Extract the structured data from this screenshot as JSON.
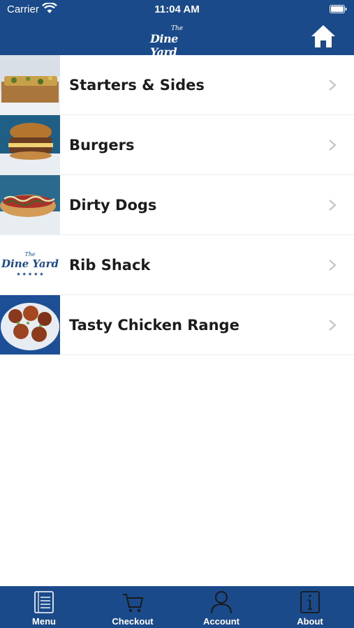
{
  "status_bar": {
    "carrier": "Carrier",
    "time": "11:04 AM"
  },
  "header": {
    "logo_small": "The",
    "logo_name": "Dine Yard",
    "home_icon": "home-icon",
    "brand_color": "#1a4a8a"
  },
  "categories": [
    {
      "label": "Starters & Sides",
      "thumb": "loaded-fries-photo"
    },
    {
      "label": "Burgers",
      "thumb": "burger-photo"
    },
    {
      "label": "Dirty Dogs",
      "thumb": "hotdog-photo"
    },
    {
      "label": "Rib Shack",
      "thumb": "dine-yard-logo"
    },
    {
      "label": "Tasty Chicken Range",
      "thumb": "chicken-wings-photo"
    }
  ],
  "tabbar": {
    "tabs": [
      {
        "label": "Menu",
        "icon": "menu-book-icon"
      },
      {
        "label": "Checkout",
        "icon": "cart-icon"
      },
      {
        "label": "Account",
        "icon": "person-icon"
      },
      {
        "label": "About",
        "icon": "info-icon"
      }
    ]
  }
}
